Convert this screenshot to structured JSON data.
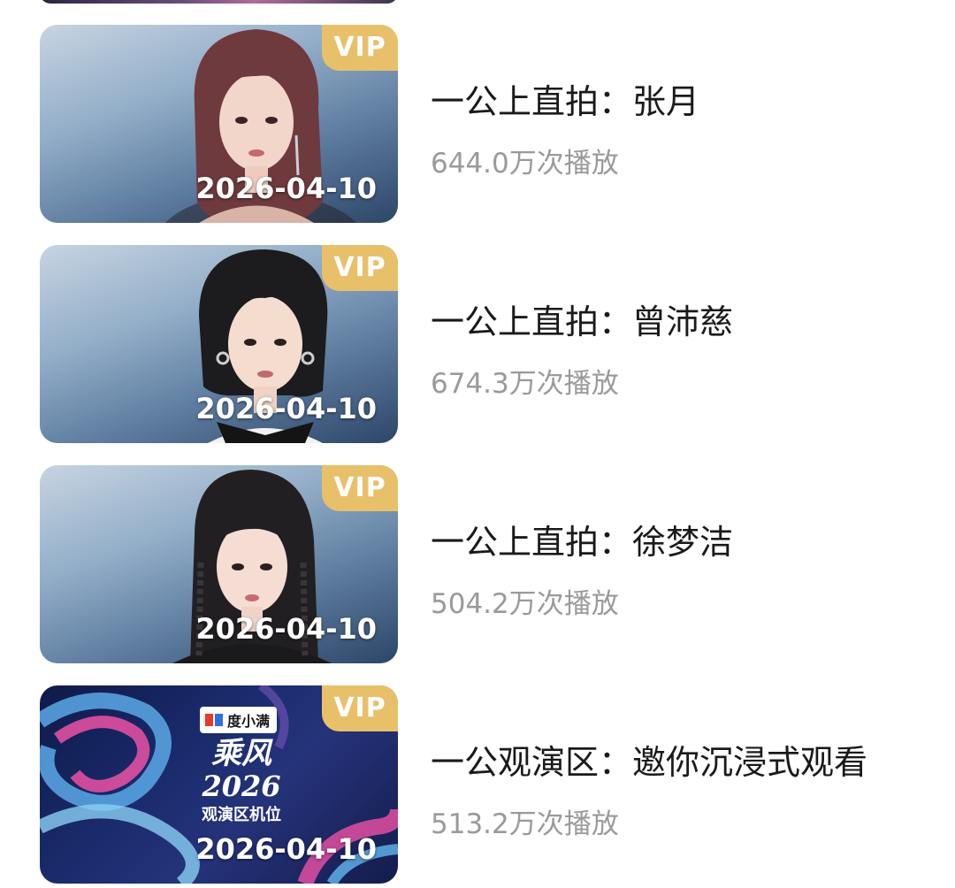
{
  "items": [
    {
      "title": "一公上直拍：张月",
      "plays": "644.0万次播放",
      "date": "2026-04-10",
      "badge": "VIP",
      "hair_color": "#6e3a3e"
    },
    {
      "title": "一公上直拍：曾沛慈",
      "plays": "674.3万次播放",
      "date": "2026-04-10",
      "badge": "VIP",
      "hair_color": "#1c1b1e"
    },
    {
      "title": "一公上直拍：徐梦洁",
      "plays": "504.2万次播放",
      "date": "2026-04-10",
      "badge": "VIP",
      "hair_color": "#221f22"
    },
    {
      "title": "一公观演区：邀你沉浸式观看",
      "plays": "513.2万次播放",
      "date": "2026-04-10",
      "badge": "VIP",
      "promo": {
        "brand": "度小满",
        "line1": "乘风",
        "line2": "2026",
        "subtitle": "观演区机位"
      }
    }
  ],
  "colors": {
    "vip_badge": "#e8c06a",
    "title_text": "#1a1a1a",
    "meta_text": "#9a9a9a"
  }
}
